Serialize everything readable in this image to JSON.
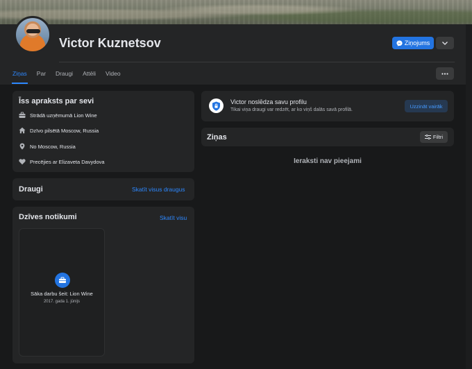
{
  "profile": {
    "name": "Victor Kuznetsov",
    "message_button": "Ziņojums"
  },
  "tabs": [
    {
      "label": "Ziņas",
      "active": true
    },
    {
      "label": "Par"
    },
    {
      "label": "Draugi"
    },
    {
      "label": "Attēli"
    },
    {
      "label": "Video"
    }
  ],
  "intro": {
    "title": "Īss apraksts par sevi",
    "items": [
      {
        "icon": "briefcase-icon",
        "text": "Strādā uzņēmumā Lion Wine"
      },
      {
        "icon": "home-icon",
        "text": "Dzīvo pilsētā Moscow, Russia"
      },
      {
        "icon": "location-pin-icon",
        "text": "No Moscow, Russia"
      },
      {
        "icon": "heart-icon",
        "text": "Precējies ar Elizaveta Davydova"
      }
    ]
  },
  "friends": {
    "title": "Draugi",
    "see_all": "Skatīt visus draugus"
  },
  "life_events": {
    "title": "Dzīves notikumi",
    "see_all": "Skatīt visu",
    "event_title": "Sāka darbu šeit: Lion Wine",
    "event_date": "2017. gada 1. jūnijs"
  },
  "locked_profile": {
    "title": "Victor noslēdza savu profilu",
    "subtitle": "Tikai viņa draugi var redzēt, ar ko viņš dalās savā profilā.",
    "button": "Uzzināt vairāk"
  },
  "posts": {
    "title": "Ziņas",
    "filter_button": "Filtri",
    "empty_text": "Ieraksti nav pieejami"
  },
  "colors": {
    "background": "#18191a",
    "card": "#242526",
    "accent": "#2d88ff",
    "primary_button": "#2374e1"
  }
}
